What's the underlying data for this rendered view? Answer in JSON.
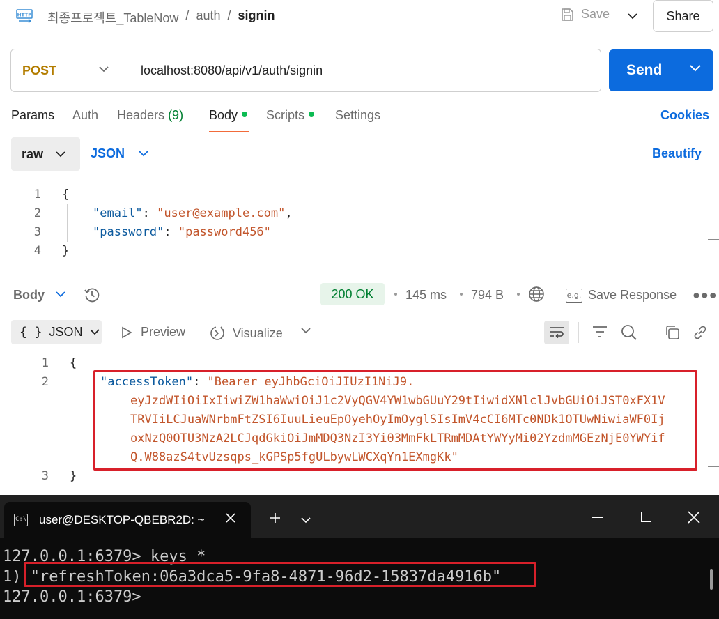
{
  "header": {
    "crumbs": [
      "최종프로젝트_TableNow",
      "/",
      "auth",
      "/"
    ],
    "current": "signin",
    "save_label": "Save",
    "share_label": "Share",
    "icon": "http-icon"
  },
  "request": {
    "method": "POST",
    "url": "localhost:8080/api/v1/auth/signin",
    "send_label": "Send"
  },
  "req_tabs": {
    "params": "Params",
    "auth": "Auth",
    "headers": "Headers",
    "headers_count": "(9)",
    "body": "Body",
    "scripts": "Scripts",
    "settings": "Settings",
    "cookies": "Cookies"
  },
  "body_mode": {
    "raw": "raw",
    "format": "JSON",
    "beautify": "Beautify"
  },
  "request_body": {
    "line_numbers": [
      "1",
      "2",
      "3",
      "4"
    ],
    "open": "{",
    "close": "}",
    "email_key": "\"email\"",
    "email_value": "\"user@example.com\"",
    "password_key": "\"password\"",
    "password_value": "\"password456\""
  },
  "response": {
    "label": "Body",
    "status": "200 OK",
    "time": "145 ms",
    "size": "794 B",
    "save_response": "Save Response",
    "eg_label": "e.g.",
    "view_mode": "JSON",
    "preview": "Preview",
    "visualize": "Visualize",
    "line_numbers": [
      "1",
      "2",
      "3"
    ],
    "open": "{",
    "close": "}",
    "token_key": "\"accessToken\"",
    "token_lines": [
      "\"Bearer eyJhbGciOiJIUzI1NiJ9.",
      "eyJzdWIiOiIxIiwiZW1haWwiOiJ1c2VyQGV4YW1wbGUuY29tIiwidXNlclJvbGUiOiJST0xFX1V",
      "TRVIiLCJuaWNrbmFtZSI6IuuLieuEpOyehOyImOyglSIsImV4cCI6MTc0NDk1OTUwNiwiaWF0Ij",
      "oxNzQ0OTU3NzA2LCJqdGkiOiJmMDQ3NzI3Yi03MmFkLTRmMDAtYWYyMi02YzdmMGEzNjE0YWYif",
      "Q.W88azS4tvUzsqps_kGPSp5fgULbywLWCXqYn1EXmgKk\""
    ]
  },
  "terminal": {
    "tab_title": "user@DESKTOP-QBEBR2D: ~",
    "lines": [
      "127.0.0.1:6379> keys *",
      "1) ",
      "127.0.0.1:6379>"
    ],
    "refresh_token": "\"refreshToken:06a3dca5-9fa8-4871-96d2-15837da4916b\""
  },
  "colors": {
    "send": "#0c6bde",
    "status_ok": "#007f31",
    "highlight_box": "#d8202a",
    "terminal_bg": "#0c0c0c"
  }
}
